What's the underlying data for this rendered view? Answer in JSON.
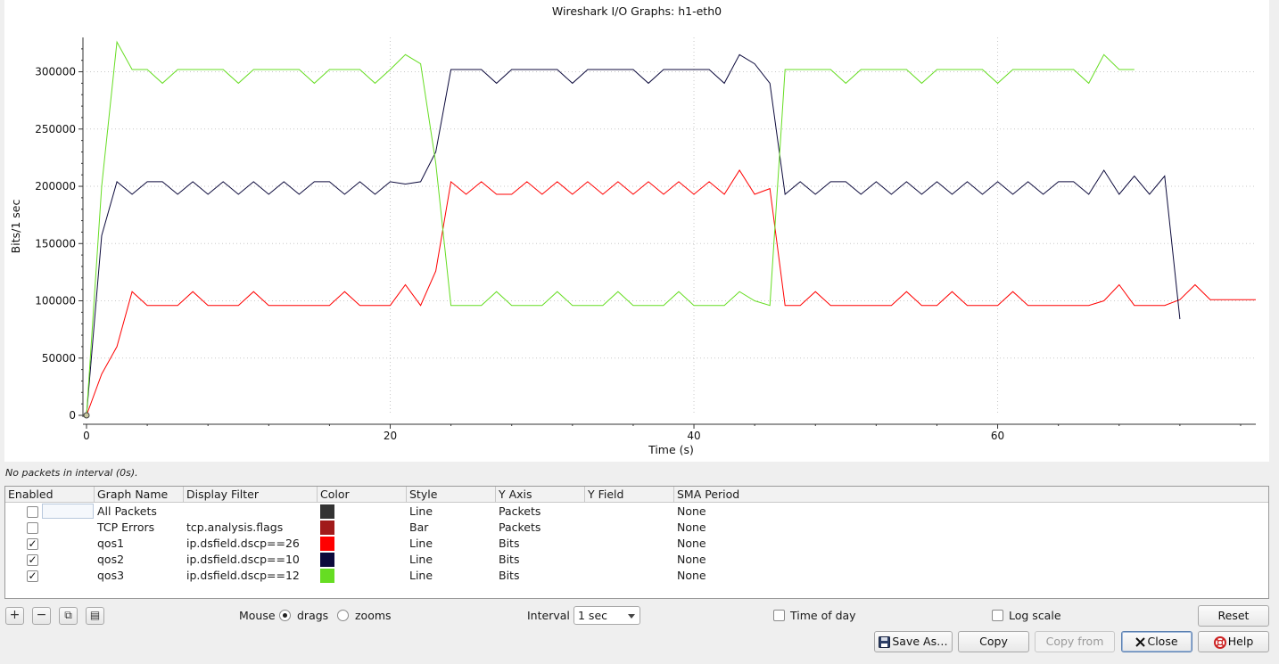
{
  "window_title": "Wireshark I/O Graphs: h1-eth0",
  "status_message": "No packets in interval (0s).",
  "chart_data": {
    "type": "line",
    "title": "Wireshark I/O Graphs: h1-eth0",
    "xlabel": "Time (s)",
    "ylabel": "Bits/1 sec",
    "xlim": [
      0,
      77
    ],
    "ylim": [
      0,
      330000
    ],
    "x_ticks": [
      0,
      20,
      40,
      60
    ],
    "y_ticks": [
      0,
      50000,
      100000,
      150000,
      200000,
      250000,
      300000
    ],
    "grid": true,
    "legend": "none",
    "series": [
      {
        "name": "qos1",
        "color": "#ff0000",
        "x": [
          0,
          1,
          2,
          3,
          4,
          5,
          6,
          7,
          8,
          9,
          10,
          11,
          12,
          13,
          14,
          15,
          16,
          17,
          18,
          19,
          20,
          21,
          22,
          23,
          24,
          25,
          26,
          27,
          28,
          29,
          30,
          31,
          32,
          33,
          34,
          35,
          36,
          37,
          38,
          39,
          40,
          41,
          42,
          43,
          44,
          45,
          46,
          47,
          48,
          49,
          50,
          51,
          52,
          53,
          54,
          55,
          56,
          57,
          58,
          59,
          60,
          61,
          62,
          63,
          64,
          65,
          66,
          67,
          68,
          69,
          70,
          71,
          72,
          73,
          74,
          75,
          76,
          77
        ],
        "y": [
          0,
          36000,
          60000,
          108000,
          96000,
          96000,
          96000,
          108000,
          96000,
          96000,
          96000,
          108000,
          96000,
          96000,
          96000,
          96000,
          96000,
          108000,
          96000,
          96000,
          96000,
          114000,
          96000,
          126000,
          204000,
          193000,
          204000,
          193000,
          193000,
          204000,
          193000,
          204000,
          193000,
          204000,
          193000,
          204000,
          193000,
          204000,
          193000,
          204000,
          193000,
          204000,
          193000,
          214000,
          193000,
          198000,
          96000,
          96000,
          108000,
          96000,
          96000,
          96000,
          96000,
          96000,
          108000,
          96000,
          96000,
          108000,
          96000,
          96000,
          96000,
          108000,
          96000,
          96000,
          96000,
          96000,
          96000,
          100000,
          114000,
          96000,
          96000,
          96000,
          101000,
          114000,
          101000,
          101000,
          101000,
          101000
        ]
      },
      {
        "name": "qos2",
        "color": "#0c0a3c",
        "x": [
          0,
          1,
          2,
          3,
          4,
          5,
          6,
          7,
          8,
          9,
          10,
          11,
          12,
          13,
          14,
          15,
          16,
          17,
          18,
          19,
          20,
          21,
          22,
          23,
          24,
          25,
          26,
          27,
          28,
          29,
          30,
          31,
          32,
          33,
          34,
          35,
          36,
          37,
          38,
          39,
          40,
          41,
          42,
          43,
          44,
          45,
          46,
          47,
          48,
          49,
          50,
          51,
          52,
          53,
          54,
          55,
          56,
          57,
          58,
          59,
          60,
          61,
          62,
          63,
          64,
          65,
          66,
          67,
          68,
          69,
          70,
          71,
          72
        ],
        "y": [
          0,
          157000,
          204000,
          193000,
          204000,
          204000,
          193000,
          204000,
          193000,
          204000,
          193000,
          204000,
          193000,
          204000,
          193000,
          204000,
          204000,
          193000,
          204000,
          193000,
          204000,
          202000,
          204000,
          230000,
          302000,
          302000,
          302000,
          290000,
          302000,
          302000,
          302000,
          302000,
          290000,
          302000,
          302000,
          302000,
          302000,
          290000,
          302000,
          302000,
          302000,
          302000,
          290000,
          315000,
          307000,
          290000,
          193000,
          204000,
          193000,
          204000,
          204000,
          193000,
          204000,
          193000,
          204000,
          193000,
          204000,
          193000,
          204000,
          193000,
          204000,
          193000,
          204000,
          193000,
          204000,
          204000,
          193000,
          214000,
          193000,
          209000,
          193000,
          209000,
          84000
        ]
      },
      {
        "name": "qos3",
        "color": "#66dd22",
        "x": [
          0,
          1,
          2,
          3,
          4,
          5,
          6,
          7,
          8,
          9,
          10,
          11,
          12,
          13,
          14,
          15,
          16,
          17,
          18,
          19,
          20,
          21,
          22,
          23,
          24,
          25,
          26,
          27,
          28,
          29,
          30,
          31,
          32,
          33,
          34,
          35,
          36,
          37,
          38,
          39,
          40,
          41,
          42,
          43,
          44,
          45,
          46,
          47,
          48,
          49,
          50,
          51,
          52,
          53,
          54,
          55,
          56,
          57,
          58,
          59,
          60,
          61,
          62,
          63,
          64,
          65,
          66,
          67,
          68,
          69
        ],
        "y": [
          0,
          200000,
          326000,
          302000,
          302000,
          290000,
          302000,
          302000,
          302000,
          302000,
          290000,
          302000,
          302000,
          302000,
          302000,
          290000,
          302000,
          302000,
          302000,
          290000,
          302000,
          315000,
          307000,
          220000,
          96000,
          96000,
          96000,
          108000,
          96000,
          96000,
          96000,
          108000,
          96000,
          96000,
          96000,
          108000,
          96000,
          96000,
          96000,
          108000,
          96000,
          96000,
          96000,
          108000,
          100000,
          96000,
          302000,
          302000,
          302000,
          302000,
          290000,
          302000,
          302000,
          302000,
          302000,
          290000,
          302000,
          302000,
          302000,
          302000,
          290000,
          302000,
          302000,
          302000,
          302000,
          302000,
          290000,
          315000,
          302000,
          302000
        ]
      }
    ],
    "origin_marker": true
  },
  "table": {
    "headers": [
      "Enabled",
      "Graph Name",
      "Display Filter",
      "Color",
      "Style",
      "Y Axis",
      "Y Field",
      "SMA Period"
    ],
    "rows": [
      {
        "enabled": "",
        "name": "All Packets",
        "filter": "",
        "color": "#333333",
        "style": "Line",
        "y_axis": "Packets",
        "y_field": "",
        "sma": "None",
        "editing": true
      },
      {
        "enabled": "",
        "name": "TCP Errors",
        "filter": "tcp.analysis.flags",
        "color": "#a11a1a",
        "style": "Bar",
        "y_axis": "Packets",
        "y_field": "",
        "sma": "None"
      },
      {
        "enabled": "✓",
        "name": "qos1",
        "filter": "ip.dsfield.dscp==26",
        "color": "#ff0000",
        "style": "Line",
        "y_axis": "Bits",
        "y_field": "",
        "sma": "None"
      },
      {
        "enabled": "✓",
        "name": "qos2",
        "filter": "ip.dsfield.dscp==10",
        "color": "#0c0a3c",
        "style": "Line",
        "y_axis": "Bits",
        "y_field": "",
        "sma": "None"
      },
      {
        "enabled": "✓",
        "name": "qos3",
        "filter": "ip.dsfield.dscp==12",
        "color": "#66dd22",
        "style": "Line",
        "y_axis": "Bits",
        "y_field": "",
        "sma": "None"
      }
    ]
  },
  "toolbar": {
    "add_glyph": "+",
    "remove_glyph": "−",
    "copy_glyph": "⧉",
    "clear_glyph": "▤"
  },
  "controls": {
    "mouse_label": "Mouse",
    "drags_label": "drags",
    "zooms_label": "zooms",
    "mouse_mode": "drags",
    "interval_label": "Interval",
    "interval_value": "1 sec",
    "time_of_day_label": "Time of day",
    "log_scale_label": "Log scale",
    "reset_label": "Reset"
  },
  "buttons": {
    "save_as": "Save As…",
    "copy": "Copy",
    "copy_from": "Copy from",
    "close": "Close",
    "help": "Help"
  }
}
